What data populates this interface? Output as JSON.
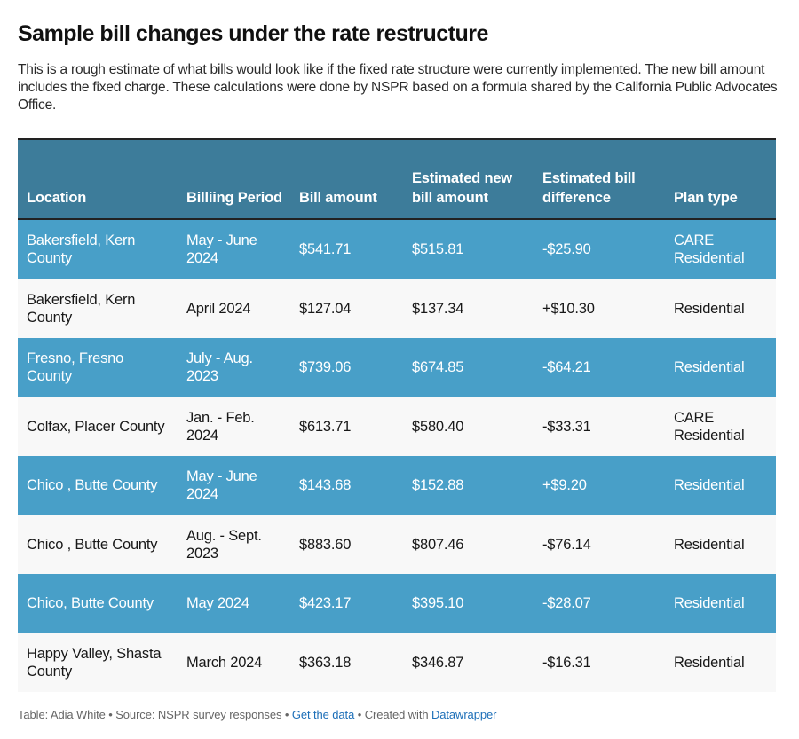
{
  "title": "Sample bill changes under the rate restructure",
  "description": "This is a rough estimate of what bills would look like if the fixed rate structure were currently implemented. The new bill amount includes the fixed charge. These calculations were done by NSPR based on a formula shared by the California Public Advocates Office.",
  "colors": {
    "header_bg": "#3d7c9a",
    "highlight_row_bg": "#489fc8",
    "plain_row_bg": "#f8f8f8",
    "link": "#1d6fb8"
  },
  "table": {
    "headers": [
      "Location",
      "Billiing Period",
      "Bill amount",
      "Estimated new bill amount",
      "Estimated bill difference",
      "Plan type"
    ],
    "rows": [
      {
        "location": "Bakersfield, Kern County",
        "period": "May - June 2024",
        "bill": "$541.71",
        "new_bill": "$515.81",
        "difference": "-$25.90",
        "plan": "CARE Residential",
        "style": "blue"
      },
      {
        "location": "Bakersfield, Kern County",
        "period": "April 2024",
        "bill": "$127.04",
        "new_bill": "$137.34",
        "difference": "+$10.30",
        "plan": "Residential",
        "style": "gray"
      },
      {
        "location": "Fresno, Fresno County",
        "period": "July - Aug. 2023",
        "bill": "$739.06",
        "new_bill": "$674.85",
        "difference": "-$64.21",
        "plan": "Residential",
        "style": "blue"
      },
      {
        "location": "Colfax, Placer County",
        "period": "Jan. - Feb. 2024",
        "bill": "$613.71",
        "new_bill": "$580.40",
        "difference": "-$33.31",
        "plan": "CARE Residential",
        "style": "gray"
      },
      {
        "location": "Chico , Butte County",
        "period": "May - June 2024",
        "bill": "$143.68",
        "new_bill": "$152.88",
        "difference": "+$9.20",
        "plan": "Residential",
        "style": "blue"
      },
      {
        "location": "Chico , Butte County",
        "period": "Aug. - Sept. 2023",
        "bill": "$883.60",
        "new_bill": "$807.46",
        "difference": "-$76.14",
        "plan": "Residential",
        "style": "gray"
      },
      {
        "location": "Chico, Butte County",
        "period": "May 2024",
        "bill": "$423.17",
        "new_bill": "$395.10",
        "difference": "-$28.07",
        "plan": "Residential",
        "style": "blue"
      },
      {
        "location": "Happy Valley, Shasta County",
        "period": "March 2024",
        "bill": "$363.18",
        "new_bill": "$346.87",
        "difference": "-$16.31",
        "plan": "Residential",
        "style": "gray"
      }
    ]
  },
  "footer": {
    "credit": "Table: Adia White ",
    "separator": " • ",
    "source": "Source: NSPR survey responses",
    "get_data_label": "Get the data",
    "created_with": "Created with ",
    "tool_label": "Datawrapper"
  }
}
